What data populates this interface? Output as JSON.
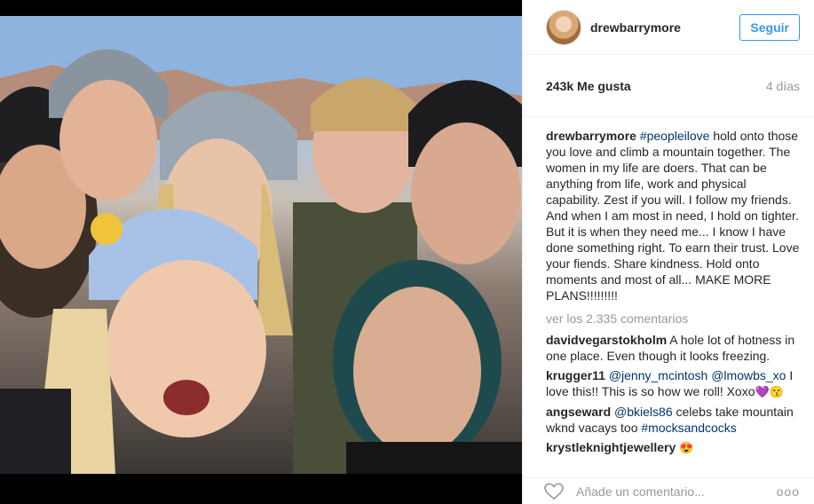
{
  "post": {
    "username": "drewbarrymore",
    "follow_label": "Seguir",
    "likes": "243k Me gusta",
    "age": "4 días",
    "caption_user": "drewbarrymore",
    "caption_tag": "#peopleilove",
    "caption_text": " hold onto those you love and climb a mountain together. The women in my life are doers. That can be anything from life, work and physical capability. Zest if you will. I follow my friends. And when I am most in need, I hold on tighter. But it is when they need me... I know I have done something right. To earn their trust. Love your fiends. Share kindness. Hold onto moments and most of all... MAKE MORE PLANS!!!!!!!!!",
    "view_comments": "ver los 2.335 comentarios"
  },
  "comments": [
    {
      "user": "davidvegarstokholm",
      "mention1": "",
      "mention2": "",
      "text": " A hole lot of hotness in one place. Even though it looks freezing.",
      "emoji": ""
    },
    {
      "user": "krugger11",
      "mention1": "@jenny_mcintosh",
      "mention2": "@lmowbs_xo",
      "text": " I love this!! This is so how we roll! Xoxo",
      "emoji": "💜😙"
    },
    {
      "user": "angseward",
      "mention1": "@bkiels86",
      "mention2": "",
      "text": " celebs take mountain wknd vacays too ",
      "tag": "#mocksandcocks",
      "emoji": ""
    },
    {
      "user": "krystleknightjewellery",
      "mention1": "",
      "mention2": "",
      "text": " ",
      "emoji": "😍"
    }
  ],
  "footer": {
    "add_comment_placeholder": "Añade un comentario...",
    "options_label": "ooo"
  },
  "icons": {
    "like": "heart-icon",
    "options": "more-options-icon"
  },
  "colors": {
    "accent": "#3897f0",
    "link": "#003569",
    "muted": "#999999"
  }
}
